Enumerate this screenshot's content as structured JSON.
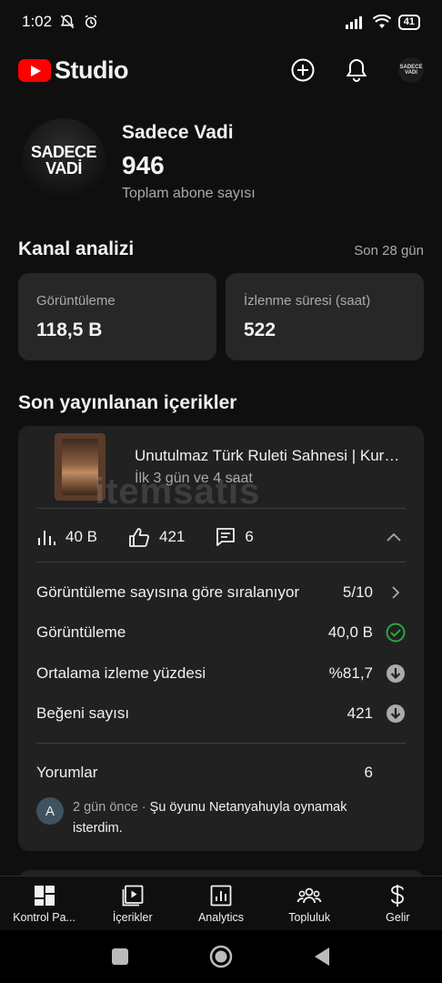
{
  "status_bar": {
    "time": "1:02",
    "battery": "41"
  },
  "app": {
    "logo_text": "Studio",
    "avatar_text": "SADECE VADI"
  },
  "channel": {
    "avatar_line1": "SADECE",
    "avatar_line2": "VADİ",
    "name": "Sadece Vadi",
    "subscribers": "946",
    "subscribers_label": "Toplam abone sayısı"
  },
  "analytics": {
    "title": "Kanal analizi",
    "period": "Son 28 gün",
    "cards": [
      {
        "label": "Görüntüleme",
        "value": "118,5 B"
      },
      {
        "label": "İzlenme süresi (saat)",
        "value": "522"
      }
    ]
  },
  "recent": {
    "title": "Son yayınlanan içerikler",
    "video": {
      "title": "Unutulmaz Türk Ruleti Sahnesi | Kurtlar Vadisi",
      "subtitle": "İlk 3 gün ve 4 saat"
    },
    "watermark": "itemsatis",
    "stats": {
      "views": "40 B",
      "likes": "421",
      "comments": "6"
    },
    "details": [
      {
        "label": "Görüntüleme sayısına göre sıralanıyor",
        "value": "5/10",
        "icon": "chevron-right-icon"
      },
      {
        "label": "Görüntüleme",
        "value": "40,0 B",
        "icon": "check-circle-icon"
      },
      {
        "label": "Ortalama izleme yüzdesi",
        "value": "%81,7",
        "icon": "arrow-down-circle-icon"
      },
      {
        "label": "Beğeni sayısı",
        "value": "421",
        "icon": "arrow-down-circle-icon"
      }
    ],
    "comments_label": "Yorumlar",
    "comments_count": "6",
    "comment": {
      "avatar": "A",
      "meta": "2 gün önce · ",
      "text": "Şu öyunu Netanyahuyla oynamak isterdim."
    }
  },
  "bottom_nav": [
    {
      "label": "Kontrol Pa...",
      "icon": "dashboard-icon"
    },
    {
      "label": "İçerikler",
      "icon": "content-icon"
    },
    {
      "label": "Analytics",
      "icon": "analytics-icon"
    },
    {
      "label": "Topluluk",
      "icon": "community-icon"
    },
    {
      "label": "Gelir",
      "icon": "dollar-icon"
    }
  ],
  "colors": {
    "background": "#0f0f0f",
    "card": "#272727",
    "brand_red": "#ff0000",
    "success_green": "#2ba640"
  }
}
